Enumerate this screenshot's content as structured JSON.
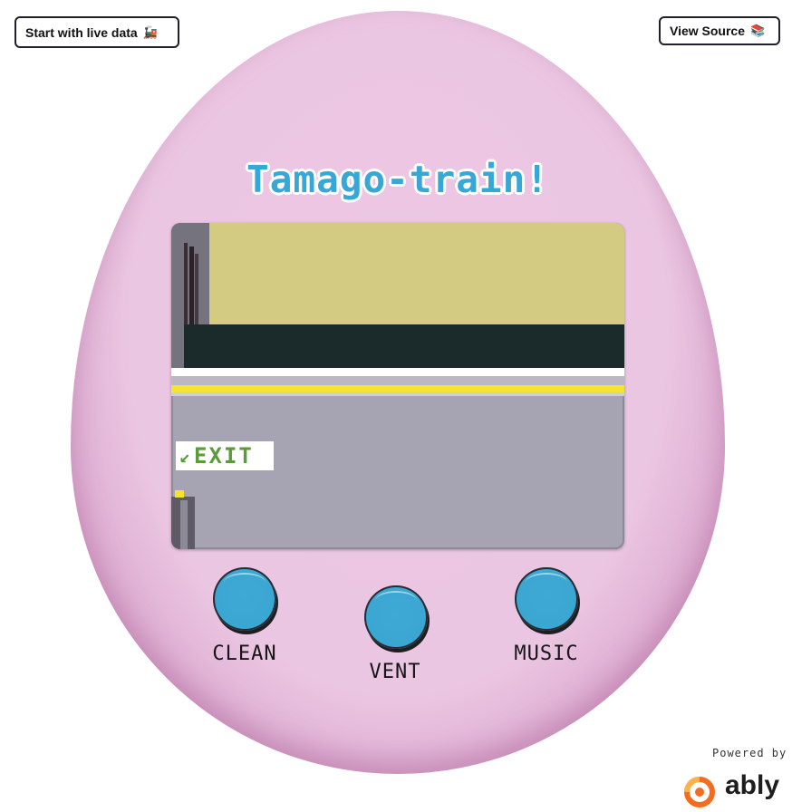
{
  "header": {
    "live_button_label": "Start with live data",
    "live_button_icon": "train-icon",
    "source_button_label": "View Source",
    "source_button_icon": "book-icon"
  },
  "device": {
    "title": "Tamago-train!",
    "title_color": "#37a8d6",
    "egg_color": "#ebc6e2"
  },
  "screen": {
    "sign_arrow": "↙",
    "sign_text": "EXIT",
    "sign_color": "#5a9c3a"
  },
  "buttons": [
    {
      "label": "CLEAN"
    },
    {
      "label": "VENT"
    },
    {
      "label": "MUSIC"
    }
  ],
  "button_color": "#3aa6d2",
  "footer": {
    "powered_by": "Powered by",
    "brand": "ably",
    "brand_color": "#f26d1f"
  }
}
